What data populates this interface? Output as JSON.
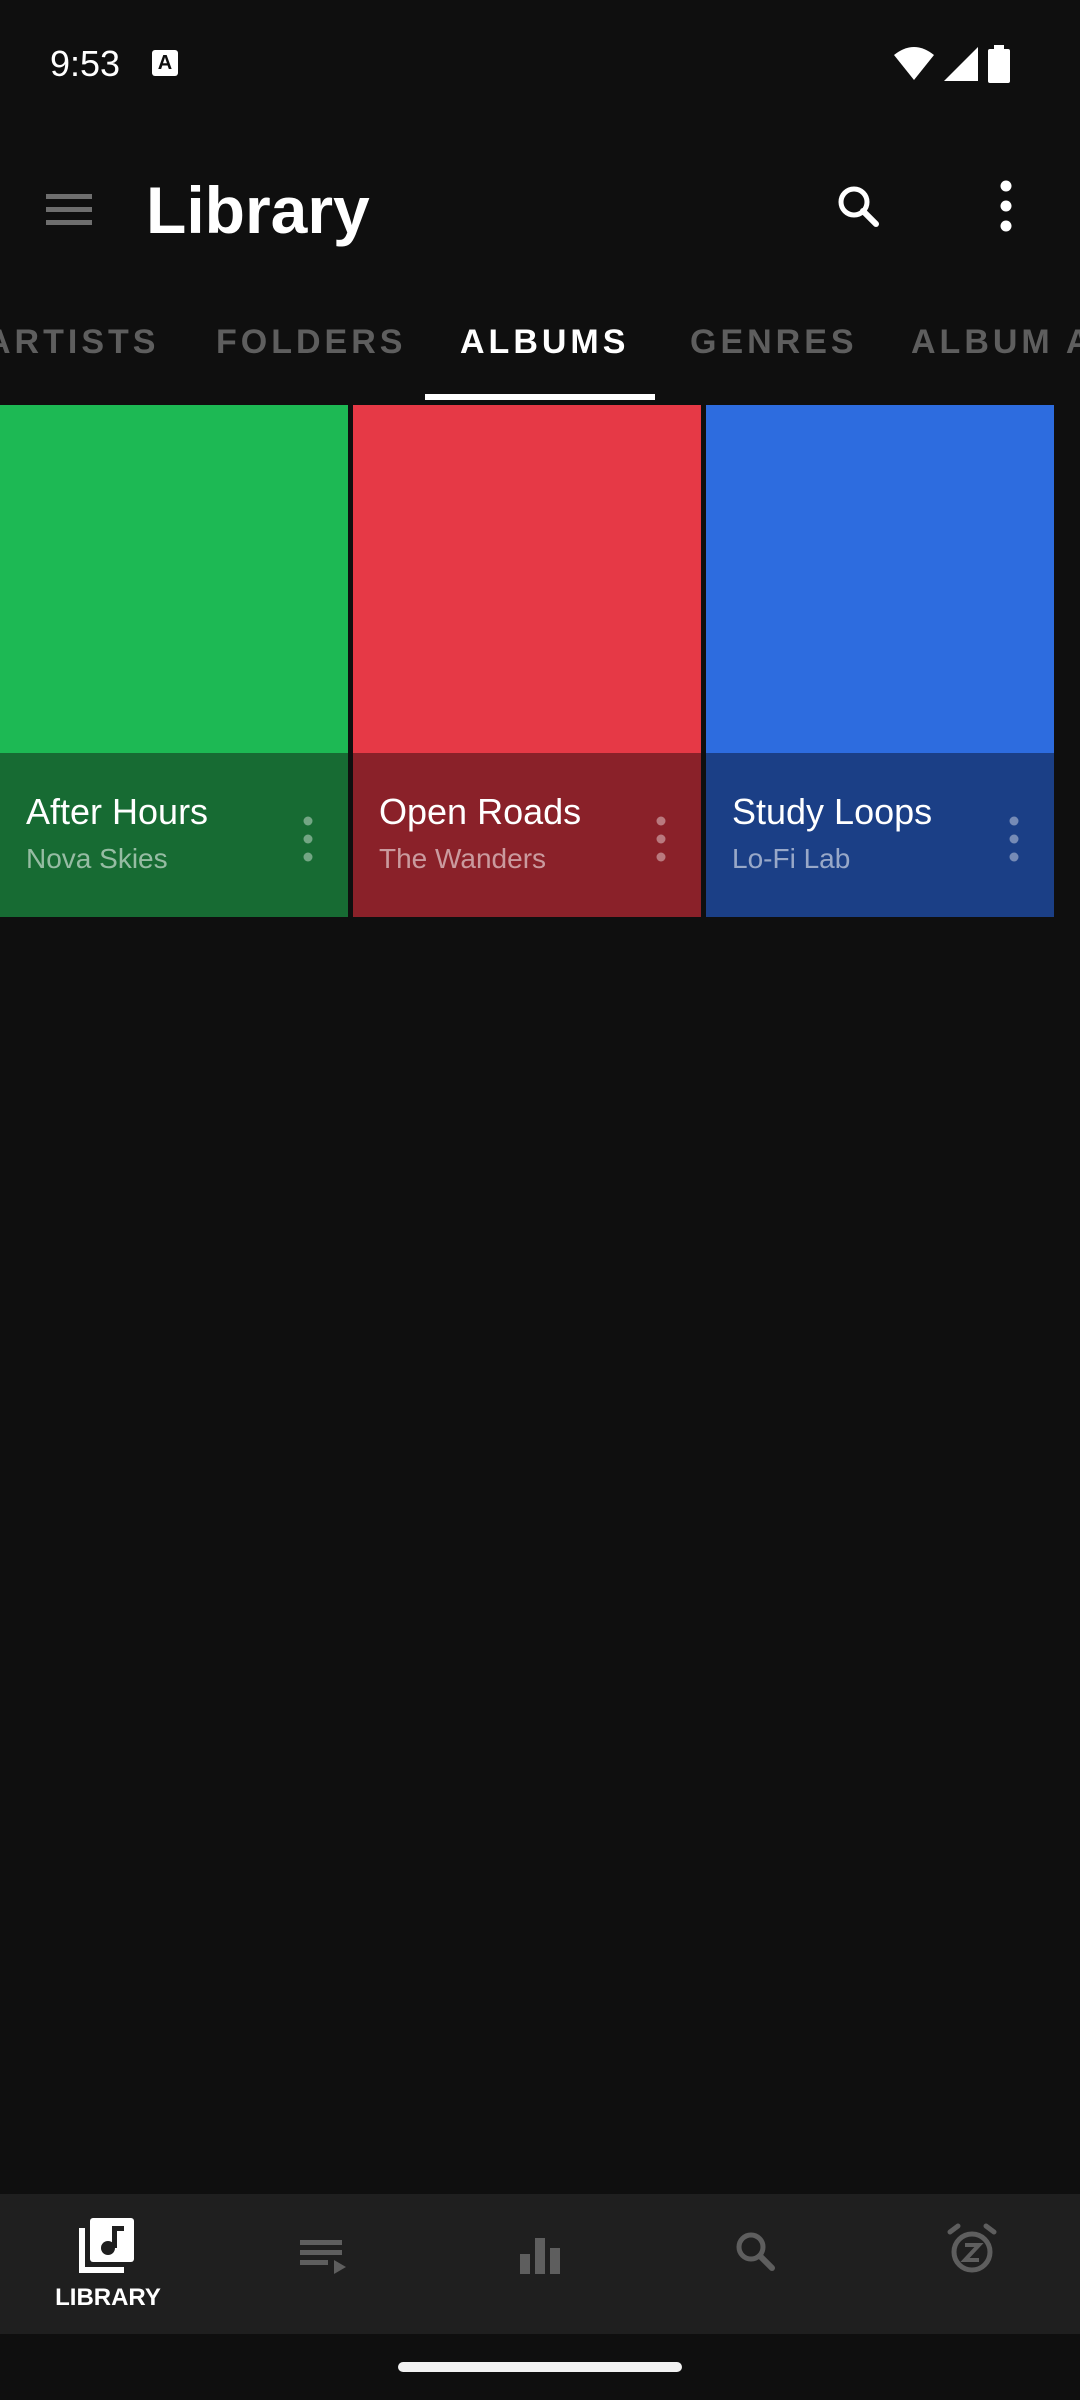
{
  "status_bar": {
    "time": "9:53",
    "notification_icon": "text-a-icon",
    "icons": [
      "wifi-icon",
      "cell-signal-icon",
      "battery-icon"
    ]
  },
  "app_bar": {
    "title": "Library",
    "menu_icon": "hamburger-menu-icon",
    "search_icon": "search-icon",
    "more_icon": "more-vertical-icon"
  },
  "tabs": [
    {
      "label": "ARTISTS",
      "active": false
    },
    {
      "label": "FOLDERS",
      "active": false
    },
    {
      "label": "ALBUMS",
      "active": true
    },
    {
      "label": "GENRES",
      "active": false
    },
    {
      "label": "ALBUM A",
      "active": false
    }
  ],
  "albums": [
    {
      "title": "After Hours",
      "artist": "Nova Skies",
      "art_color": "#1db954",
      "info_color": "#176b33"
    },
    {
      "title": "Open Roads",
      "artist": "The Wanders",
      "art_color": "#e63946",
      "info_color": "#8a2129"
    },
    {
      "title": "Study Loops",
      "artist": "Lo-Fi Lab",
      "art_color": "#2d6cdf",
      "info_color": "#1b3f86"
    }
  ],
  "bottom_nav": [
    {
      "label": "LIBRARY",
      "icon": "library-music-icon",
      "active": true
    },
    {
      "label": "",
      "icon": "playlist-play-icon",
      "active": false
    },
    {
      "label": "",
      "icon": "bar-chart-icon",
      "active": false
    },
    {
      "label": "",
      "icon": "search-icon",
      "active": false
    },
    {
      "label": "",
      "icon": "sleep-timer-icon",
      "active": false
    }
  ],
  "colors": {
    "background": "#0f0f0f",
    "bottom_nav": "#1f1f1f",
    "tab_active": "#ffffff",
    "tab_inactive": "#5e5e5e"
  }
}
